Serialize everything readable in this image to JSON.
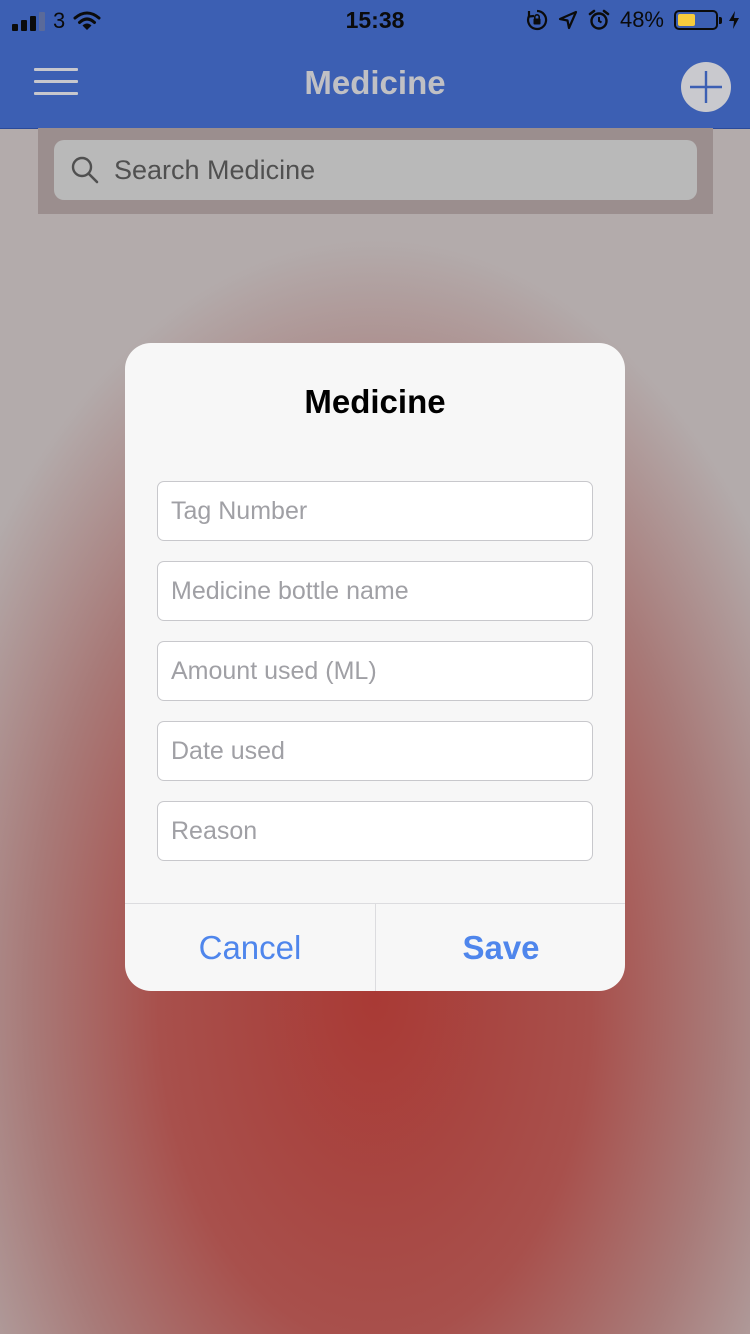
{
  "status_bar": {
    "carrier": "3",
    "time": "15:38",
    "battery_percent": "48%",
    "battery_level": 0.48,
    "battery_color": "#f7cc3d",
    "icons": [
      "signal-bars-icon",
      "wifi-icon",
      "orientation-lock-icon",
      "location-arrow-icon",
      "alarm-clock-icon",
      "battery-icon",
      "charging-bolt-icon"
    ]
  },
  "nav_bar": {
    "title": "Medicine",
    "left_icon": "hamburger-menu-icon",
    "right_icon": "plus-icon",
    "color": "#3c5fb3"
  },
  "search": {
    "placeholder": "Search Medicine",
    "icon": "search-icon"
  },
  "dialog": {
    "title": "Medicine",
    "fields": [
      {
        "placeholder": "Tag Number",
        "value": ""
      },
      {
        "placeholder": "Medicine bottle name",
        "value": ""
      },
      {
        "placeholder": "Amount used (ML)",
        "value": ""
      },
      {
        "placeholder": "Date used",
        "value": ""
      },
      {
        "placeholder": "Reason",
        "value": ""
      }
    ],
    "cancel_label": "Cancel",
    "save_label": "Save",
    "button_color": "#4f86ec"
  }
}
